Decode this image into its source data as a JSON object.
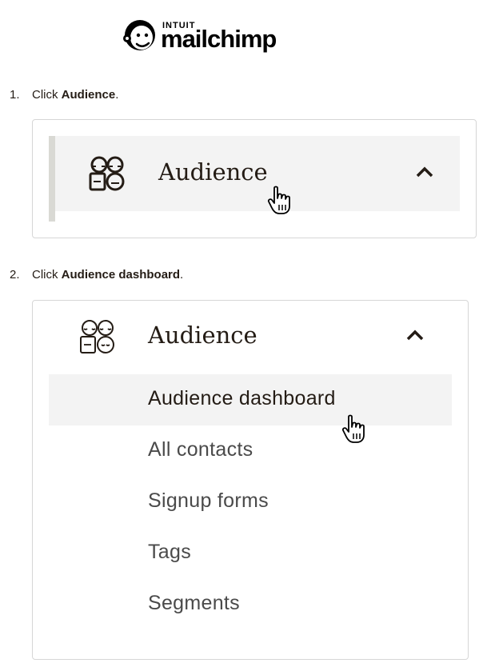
{
  "logo": {
    "small": "INTUIT",
    "word": "mailchimp"
  },
  "steps": [
    {
      "number": "1.",
      "prefix": "Click ",
      "target": "Audience",
      "suffix": "."
    },
    {
      "number": "2.",
      "prefix": "Click ",
      "target": "Audience dashboard",
      "suffix": "."
    }
  ],
  "panel1": {
    "nav_label": "Audience",
    "icon": "audience-icon",
    "toggle_icon": "chevron-up-icon"
  },
  "panel2": {
    "nav_label": "Audience",
    "icon": "audience-icon",
    "toggle_icon": "chevron-up-icon",
    "items": [
      {
        "label": "Audience dashboard",
        "active": true
      },
      {
        "label": "All contacts"
      },
      {
        "label": "Signup forms"
      },
      {
        "label": "Tags"
      },
      {
        "label": "Segments"
      }
    ]
  },
  "cursor_icon": "hand-pointer-icon",
  "colors": {
    "text": "#241c15",
    "muted_text": "#4a4a4a",
    "highlight": "#f3f3f3",
    "active_bar": "#d9d9d4",
    "border": "#d6d6d6"
  }
}
